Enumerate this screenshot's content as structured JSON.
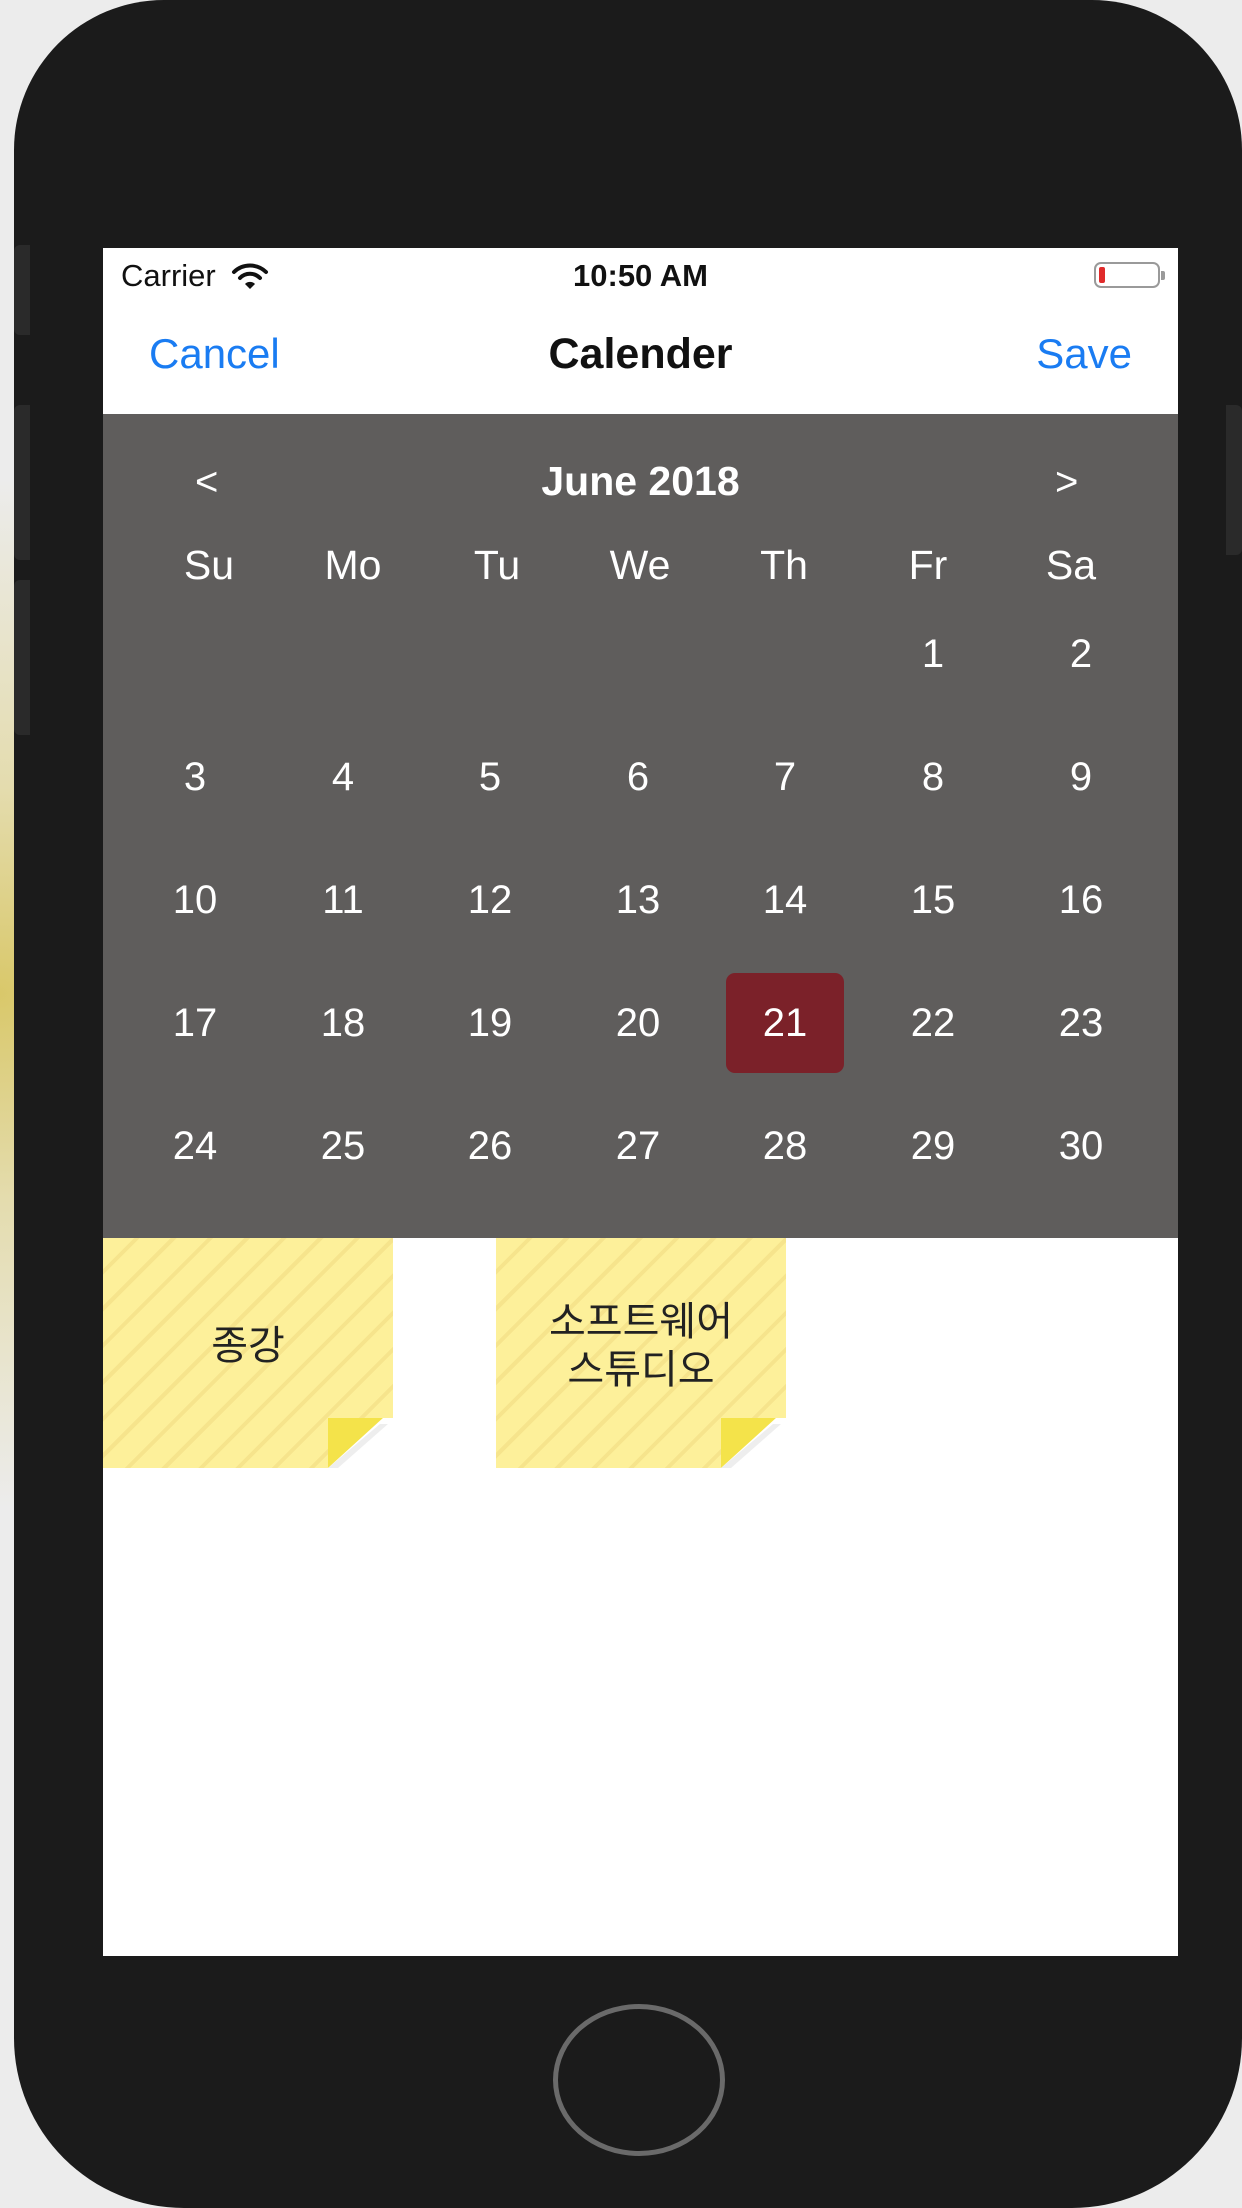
{
  "status_bar": {
    "carrier": "Carrier",
    "time": "10:50 AM",
    "battery_level": 0.1,
    "battery_color": "#e02b2b"
  },
  "nav": {
    "cancel": "Cancel",
    "title": "Calender",
    "save": "Save",
    "accent_color": "#1a7cf2"
  },
  "calendar": {
    "prev": "<",
    "next": ">",
    "month_title": "June 2018",
    "weekdays": [
      "Su",
      "Mo",
      "Tu",
      "We",
      "Th",
      "Fr",
      "Sa"
    ],
    "weeks": [
      [
        "",
        "",
        "",
        "",
        "",
        "1",
        "2"
      ],
      [
        "3",
        "4",
        "5",
        "6",
        "7",
        "8",
        "9"
      ],
      [
        "10",
        "11",
        "12",
        "13",
        "14",
        "15",
        "16"
      ],
      [
        "17",
        "18",
        "19",
        "20",
        "21",
        "22",
        "23"
      ],
      [
        "24",
        "25",
        "26",
        "27",
        "28",
        "29",
        "30"
      ]
    ],
    "selected_day": "21",
    "background_color": "#5f5d5c",
    "selected_color": "#7b2129"
  },
  "notes": [
    {
      "text": "종강"
    },
    {
      "text": "소프트웨어\n스튜디오"
    }
  ],
  "note_color": "#fdf09a"
}
